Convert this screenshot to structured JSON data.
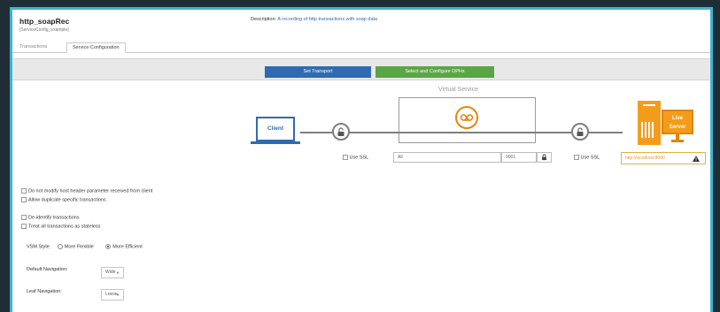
{
  "header": {
    "title": "http_soapRec",
    "subtitle": "[ServiceConfig_example]",
    "description_label": "Description:",
    "description_text": "A recording of http transactions with soap data"
  },
  "tabs": [
    {
      "label": "Transactions",
      "active": false
    },
    {
      "label": "Service Configuration",
      "active": true
    }
  ],
  "steps": {
    "set_transport": "Set Transport",
    "configure_dphs": "Select and Configure DPHs"
  },
  "diagram": {
    "virtual_service_label": "Virtual Service",
    "client_label": "Client",
    "live_server_line1": "Live",
    "live_server_line2": "Server"
  },
  "transport": {
    "use_ssl_left": "Use SSL",
    "listen_host": "All",
    "listen_port": "9001",
    "use_ssl_right": "Use SSL",
    "live_url_placeholder": "http://localhost:8080"
  },
  "options": {
    "no_modify_host": "Do not modify host header parameter received from client",
    "allow_duplicate": "Allow duplicate specific transactions",
    "deidentify": "De-identify transactions",
    "stateless": "Treat all transactions as stateless"
  },
  "vsm": {
    "label": "VSM Style:",
    "flexible": "More Flexible",
    "efficient": "More Efficient",
    "selected": "More Efficient"
  },
  "navigation": {
    "default_label": "Default Navigation:",
    "default_value": "Wide",
    "leaf_label": "Leaf Navigation:",
    "leaf_value": "Loose"
  },
  "colors": {
    "set_transport": "#2f6bb0",
    "configure_dphs": "#5aa646",
    "accent_border": "#3fb3d0",
    "server": "#f39c1b"
  }
}
